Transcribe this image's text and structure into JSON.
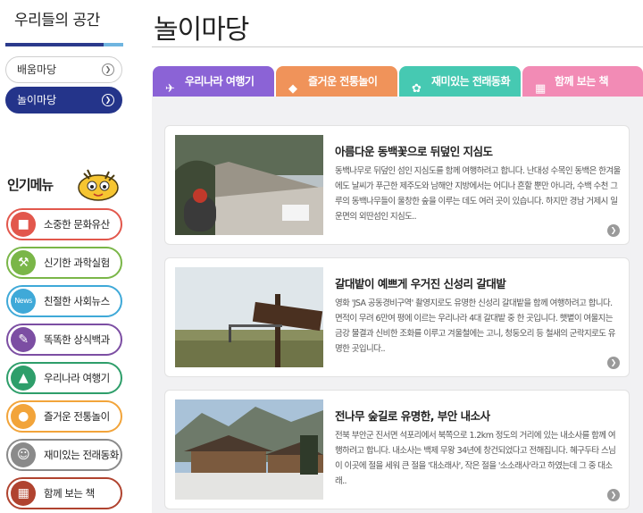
{
  "sidebar": {
    "title": "우리들의 공간",
    "nav": [
      {
        "label": "배움마당",
        "active": false
      },
      {
        "label": "놀이마당",
        "active": true
      }
    ],
    "popular_title": "인기메뉴",
    "menu": [
      {
        "label": "소중한 문화유산",
        "color": "#e2574c",
        "icon": "heritage-icon"
      },
      {
        "label": "신기한 과학실험",
        "color": "#7ab648",
        "icon": "flask-icon"
      },
      {
        "label": "친절한 사회뉴스",
        "color": "#3fa9d8",
        "icon": "news-icon"
      },
      {
        "label": "똑똑한 상식백과",
        "color": "#7c4ea3",
        "icon": "book-icon"
      },
      {
        "label": "우리나라 여행기",
        "color": "#2e9e6a",
        "icon": "travel-icon"
      },
      {
        "label": "즐거운 전통놀이",
        "color": "#f2a43a",
        "icon": "game-icon"
      },
      {
        "label": "재미있는 전래동화",
        "color": "#8a8a8a",
        "icon": "story-icon"
      },
      {
        "label": "함께 보는 책",
        "color": "#b0432f",
        "icon": "books-icon"
      }
    ]
  },
  "main": {
    "title": "놀이마당",
    "tabs": [
      {
        "label": "우리나라 여행기",
        "color": "#8b63d6",
        "icon": "travel-icon"
      },
      {
        "label": "즐거운 전통놀이",
        "color": "#f0935a",
        "icon": "kite-icon"
      },
      {
        "label": "재미있는 전래동화",
        "color": "#46c9b2",
        "icon": "story-icon"
      },
      {
        "label": "함께 보는 책",
        "color": "#f28bb5",
        "icon": "book-icon"
      }
    ],
    "cards": [
      {
        "title": "아름다운 동백꽃으로 뒤덮인 지심도",
        "desc": "동백나무로 뒤덮인 섬인 지심도를 함께 여행하려고 합니다. 난대성 수목인 동백은 한겨울에도 날씨가 푸근한 제주도와 남해안 지방에서는 어디나 흔할 뿐만 아니라, 수백 수천 그루의 동백나무들이 울창한 숲을 이루는 데도 여러 곳이 있습니다. 하지만 경남 거제시 일운면의 외딴섬인 지심도.."
      },
      {
        "title": "갈대밭이 예쁘게 우거진 신성리 갈대밭",
        "desc": "영화 'JSA 공동경비구역' 촬영지로도 유명한 신성리 갈대밭을 함께 여행하려고 합니다. 면적이 무려 6만여 평에 이르는 우리나라 4대 갈대밭 중 한 곳입니다. 햇볕이 여울지는 금강 물결과 신비한 조화를 이루고 겨울철에는 고니, 청둥오리 등 철새의 군락지로도 유명한 곳입니다.."
      },
      {
        "title": "전나무 숲길로 유명한, 부안 내소사",
        "desc": "전북 부안군 진서면 석포리에서 북쪽으로 1.2km 정도의 거리에 있는 내소사를 함께 여행하려고 합니다. 내소사는 백제 무왕 34년에 창건되었다고 전해집니다. 혜구두타 스님이 이곳에 절을 세워 큰 절을 '대소래사', 작은 절을 '소소래사'라고 하였는데 그 중 대소래.."
      }
    ]
  }
}
